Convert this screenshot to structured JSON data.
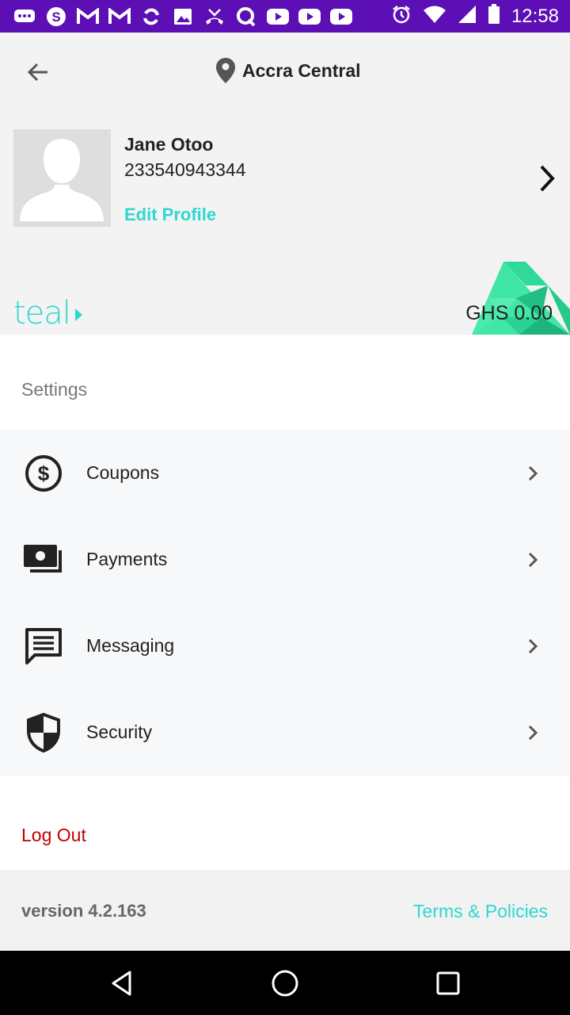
{
  "status_bar": {
    "time": "12:58",
    "notification_icons": [
      "messages-icon",
      "skype-icon",
      "gmail-icon",
      "gmail-icon",
      "sync-icon",
      "image-icon",
      "missed-call-icon",
      "q-icon",
      "youtube-icon",
      "youtube-icon",
      "youtube-icon"
    ],
    "system_icons": [
      "alarm-icon",
      "wifi-icon",
      "signal-icon",
      "battery-icon"
    ]
  },
  "header": {
    "location": "Accra Central"
  },
  "profile": {
    "name": "Jane Otoo",
    "phone": "233540943344",
    "edit_label": "Edit Profile"
  },
  "wallet": {
    "brand": "teal",
    "balance": "GHS 0.00"
  },
  "settings": {
    "title": "Settings",
    "items": [
      {
        "label": "Coupons",
        "icon": "coupon-dollar-icon"
      },
      {
        "label": "Payments",
        "icon": "payments-cash-icon"
      },
      {
        "label": "Messaging",
        "icon": "message-icon"
      },
      {
        "label": "Security",
        "icon": "shield-icon"
      }
    ]
  },
  "logout_label": "Log Out",
  "footer": {
    "version": "version 4.2.163",
    "terms": "Terms & Policies"
  },
  "colors": {
    "status_bar": "#5b0fb5",
    "accent": "#2ed7d0",
    "logout": "#c00000"
  }
}
